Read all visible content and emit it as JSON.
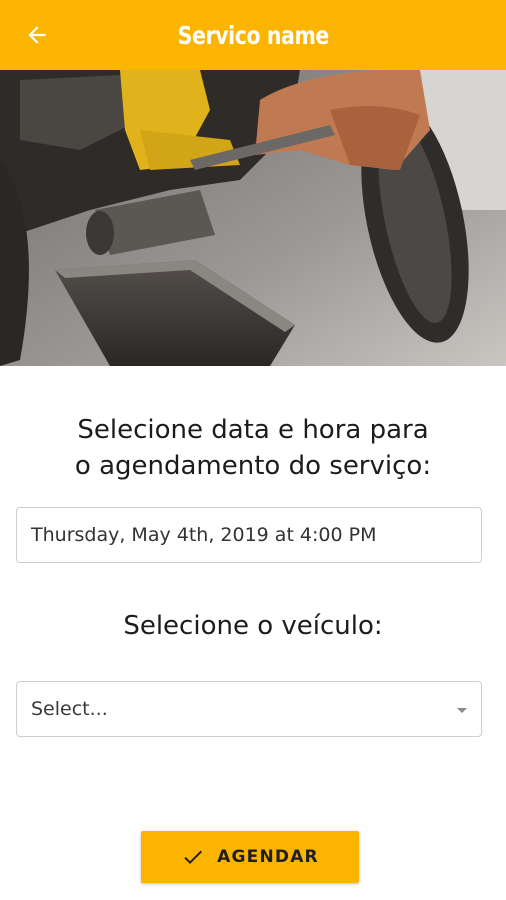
{
  "appbar": {
    "title": "Servico name",
    "back_icon": "arrow-left-icon",
    "color": "#fbb400"
  },
  "hero": {
    "description_icon": "motorcycle-repair-photo"
  },
  "form": {
    "datetime_heading_line1": "Selecione data e hora para",
    "datetime_heading_line2": "o agendamento do serviço:",
    "datetime_value": "Thursday, May 4th, 2019 at 4:00 PM",
    "vehicle_heading": "Selecione o veículo:",
    "vehicle_select_placeholder": "Select..."
  },
  "actions": {
    "submit_label": "AGENDAR",
    "submit_icon": "check-icon"
  }
}
